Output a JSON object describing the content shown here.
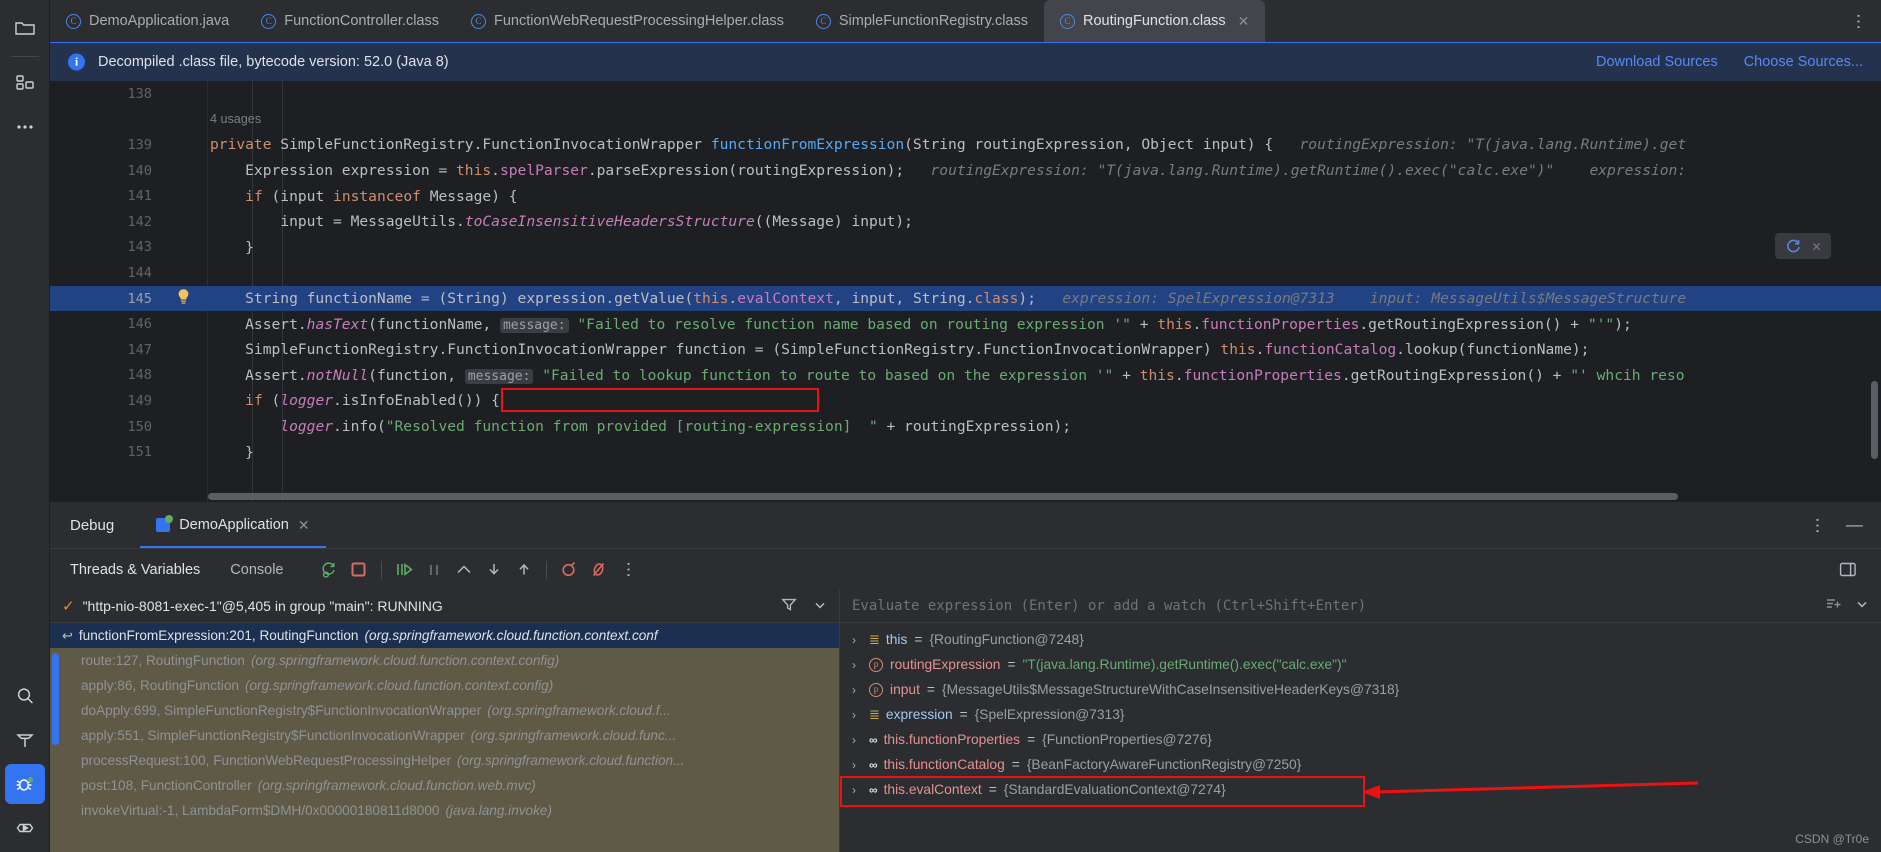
{
  "rail": {
    "icons": [
      {
        "name": "project-folder-icon",
        "label": "Project"
      },
      {
        "name": "structure-icon",
        "label": "Structure"
      },
      {
        "name": "more-tool-windows-icon",
        "label": "More"
      },
      {
        "name": "search-icon",
        "label": "Search"
      },
      {
        "name": "build-hammer-icon",
        "label": "Build"
      },
      {
        "name": "debug-bug-icon",
        "label": "Debug"
      },
      {
        "name": "run-icon",
        "label": "Run"
      }
    ]
  },
  "tabs": [
    {
      "label": "DemoApplication.java",
      "icon": "java-class-icon",
      "active": false,
      "closable": false
    },
    {
      "label": "FunctionController.class",
      "icon": "java-class-icon",
      "active": false,
      "closable": false
    },
    {
      "label": "FunctionWebRequestProcessingHelper.class",
      "icon": "java-class-icon",
      "active": false,
      "closable": false
    },
    {
      "label": "SimpleFunctionRegistry.class",
      "icon": "java-class-icon",
      "active": false,
      "closable": false
    },
    {
      "label": "RoutingFunction.class",
      "icon": "java-class-icon",
      "active": true,
      "closable": true
    }
  ],
  "banner": {
    "message": "Decompiled .class file, bytecode version: 52.0 (Java 8)",
    "download_sources": "Download Sources",
    "choose_sources": "Choose Sources..."
  },
  "editor": {
    "usage_label": "4 usages",
    "lines": [
      {
        "num": "138",
        "segments": []
      },
      {
        "num": "139",
        "segments": [
          {
            "t": "private ",
            "c": "kw"
          },
          {
            "t": "SimpleFunctionRegistry.FunctionInvocationWrapper ",
            "c": "ty"
          },
          {
            "t": "functionFromExpression",
            "c": "fn"
          },
          {
            "t": "(String routingExpression, Object input) {",
            "c": "pl"
          },
          {
            "t": "   routingExpression: \"T(java.lang.Runtime).get",
            "c": "hint"
          }
        ]
      },
      {
        "num": "140",
        "segments": [
          {
            "t": "    Expression expression = ",
            "c": "pl"
          },
          {
            "t": "this",
            "c": "kw"
          },
          {
            "t": ".",
            "c": "pl"
          },
          {
            "t": "spelParser",
            "c": "fld"
          },
          {
            "t": ".parseExpression(routingExpression);",
            "c": "pl"
          },
          {
            "t": "   routingExpression: \"T(java.lang.Runtime).getRuntime().exec(\"calc.exe\")\"    expression:",
            "c": "hint"
          }
        ]
      },
      {
        "num": "141",
        "segments": [
          {
            "t": "    ",
            "c": "pl"
          },
          {
            "t": "if",
            "c": "kw"
          },
          {
            "t": " (input ",
            "c": "pl"
          },
          {
            "t": "instanceof",
            "c": "kw"
          },
          {
            "t": " Message) {",
            "c": "pl"
          }
        ]
      },
      {
        "num": "142",
        "segments": [
          {
            "t": "        input = MessageUtils.",
            "c": "pl"
          },
          {
            "t": "toCaseInsensitiveHeadersStructure",
            "c": "statf"
          },
          {
            "t": "((Message) input);",
            "c": "pl"
          }
        ]
      },
      {
        "num": "143",
        "segments": [
          {
            "t": "    }",
            "c": "pl"
          }
        ]
      },
      {
        "num": "144",
        "segments": []
      },
      {
        "num": "145",
        "highlight": true,
        "bulb": true,
        "segments": [
          {
            "t": "    String functionName = (String) ",
            "c": "pl"
          },
          {
            "t": "expression.getValue(",
            "c": "pl"
          },
          {
            "t": "this",
            "c": "kw"
          },
          {
            "t": ".",
            "c": "pl"
          },
          {
            "t": "evalContext",
            "c": "fld"
          },
          {
            "t": ", input, String.",
            "c": "pl"
          },
          {
            "t": "class",
            "c": "kw"
          },
          {
            "t": ");",
            "c": "pl"
          },
          {
            "t": "   expression: SpelExpression@7313    input: MessageUtils$MessageStructure",
            "c": "hint"
          }
        ]
      },
      {
        "num": "146",
        "segments": [
          {
            "t": "    Assert.",
            "c": "pl"
          },
          {
            "t": "hasText",
            "c": "statf"
          },
          {
            "t": "(functionName, ",
            "c": "pl"
          },
          {
            "t": "message:",
            "c": "pnam"
          },
          {
            "t": " \"Failed to resolve function name based on routing expression '\"",
            "c": "str"
          },
          {
            "t": " + ",
            "c": "pl"
          },
          {
            "t": "this",
            "c": "kw"
          },
          {
            "t": ".",
            "c": "pl"
          },
          {
            "t": "functionProperties",
            "c": "fld"
          },
          {
            "t": ".getRoutingExpression() + ",
            "c": "pl"
          },
          {
            "t": "\"'\"",
            "c": "str"
          },
          {
            "t": ");",
            "c": "pl"
          }
        ]
      },
      {
        "num": "147",
        "segments": [
          {
            "t": "    SimpleFunctionRegistry.FunctionInvocationWrapper function = (SimpleFunctionRegistry.FunctionInvocationWrapper) ",
            "c": "pl"
          },
          {
            "t": "this",
            "c": "kw"
          },
          {
            "t": ".",
            "c": "pl"
          },
          {
            "t": "functionCatalog",
            "c": "fld"
          },
          {
            "t": ".lookup(functionName);",
            "c": "pl"
          }
        ]
      },
      {
        "num": "148",
        "segments": [
          {
            "t": "    Assert.",
            "c": "pl"
          },
          {
            "t": "notNull",
            "c": "statf"
          },
          {
            "t": "(function, ",
            "c": "pl"
          },
          {
            "t": "message:",
            "c": "pnam"
          },
          {
            "t": " \"Failed to lookup function to route to based on the expression '\"",
            "c": "str"
          },
          {
            "t": " + ",
            "c": "pl"
          },
          {
            "t": "this",
            "c": "kw"
          },
          {
            "t": ".",
            "c": "pl"
          },
          {
            "t": "functionProperties",
            "c": "fld"
          },
          {
            "t": ".getRoutingExpression() + ",
            "c": "pl"
          },
          {
            "t": "\"' whcih reso",
            "c": "str"
          }
        ]
      },
      {
        "num": "149",
        "segments": [
          {
            "t": "    ",
            "c": "pl"
          },
          {
            "t": "if",
            "c": "kw"
          },
          {
            "t": " (",
            "c": "pl"
          },
          {
            "t": "logger",
            "c": "statf"
          },
          {
            "t": ".isInfoEnabled()) {",
            "c": "pl"
          }
        ]
      },
      {
        "num": "150",
        "segments": [
          {
            "t": "        ",
            "c": "pl"
          },
          {
            "t": "logger",
            "c": "statf"
          },
          {
            "t": ".info(",
            "c": "pl"
          },
          {
            "t": "\"Resolved function from provided [routing-expression]  \"",
            "c": "str"
          },
          {
            "t": " + routingExpression);",
            "c": "pl"
          }
        ]
      },
      {
        "num": "151",
        "segments": [
          {
            "t": "    }",
            "c": "pl"
          }
        ]
      }
    ]
  },
  "debug": {
    "title": "Debug",
    "tab_label": "DemoApplication",
    "subtabs": [
      {
        "label": "Threads & Variables",
        "active": true
      },
      {
        "label": "Console",
        "active": false
      }
    ],
    "toolbar_icons": [
      "rerun-icon",
      "stop-icon",
      "resume-program-icon",
      "pause-program-icon",
      "step-over-icon",
      "step-into-icon",
      "step-out-icon",
      "view-breakpoints-icon",
      "mute-breakpoints-icon",
      "more-options-icon"
    ],
    "layout_settings_icon": "layout-settings-icon",
    "minimize_icon": "minimize-icon",
    "options_icon": "options-kebab-icon",
    "thread": "\"http-nio-8081-exec-1\"@5,405 in group \"main\": RUNNING",
    "frames": [
      {
        "text": "functionFromExpression:201, RoutingFunction ",
        "pkg": "(org.springframework.cloud.function.context.conf",
        "selected": true
      },
      {
        "text": "route:127, RoutingFunction ",
        "pkg": "(org.springframework.cloud.function.context.config)",
        "selected": false
      },
      {
        "text": "apply:86, RoutingFunction ",
        "pkg": "(org.springframework.cloud.function.context.config)",
        "selected": false
      },
      {
        "text": "doApply:699, SimpleFunctionRegistry$FunctionInvocationWrapper ",
        "pkg": "(org.springframework.cloud.f...",
        "selected": false
      },
      {
        "text": "apply:551, SimpleFunctionRegistry$FunctionInvocationWrapper ",
        "pkg": "(org.springframework.cloud.func...",
        "selected": false
      },
      {
        "text": "processRequest:100, FunctionWebRequestProcessingHelper ",
        "pkg": "(org.springframework.cloud.function...",
        "selected": false
      },
      {
        "text": "post:108, FunctionController ",
        "pkg": "(org.springframework.cloud.function.web.mvc)",
        "selected": false
      },
      {
        "text": "invokeVirtual:-1, LambdaForm$DMH/0x00000180811d8000 ",
        "pkg": "(java.lang.invoke)",
        "selected": false
      }
    ],
    "watch_placeholder": "Evaluate expression (Enter) or add a watch (Ctrl+Shift+Enter)",
    "variables": [
      {
        "icon": "object-icon",
        "name": "this",
        "value": "{RoutingFunction@7248}",
        "value_kind": "obj",
        "highlight": false
      },
      {
        "icon": "param-icon",
        "name": "routingExpression",
        "value": "\"T(java.lang.Runtime).getRuntime().exec(\"calc.exe\")\"",
        "value_kind": "str",
        "highlight": false
      },
      {
        "icon": "param-icon",
        "name": "input",
        "value": "{MessageUtils$MessageStructureWithCaseInsensitiveHeaderKeys@7318}",
        "value_kind": "obj",
        "highlight": false
      },
      {
        "icon": "object-icon",
        "name": "expression",
        "value": "{SpelExpression@7313}",
        "value_kind": "obj",
        "highlight": false
      },
      {
        "icon": "field-icon",
        "name": "this.functionProperties",
        "value": "{FunctionProperties@7276}",
        "value_kind": "obj",
        "highlight": false
      },
      {
        "icon": "field-icon",
        "name": "this.functionCatalog",
        "value": "{BeanFactoryAwareFunctionRegistry@7250}",
        "value_kind": "obj",
        "highlight": false
      },
      {
        "icon": "field-icon",
        "name": "this.evalContext",
        "value": "{StandardEvaluationContext@7274}",
        "value_kind": "obj",
        "highlight": true
      }
    ]
  },
  "watermark": "CSDN @Tr0e",
  "colors": {
    "accent": "#3574f0",
    "annotation_red": "#ee1111",
    "banner_bg": "#25324d",
    "editor_bg": "#1e1f22",
    "panel_bg": "#2b2d30",
    "selection_blue": "#214283",
    "string_green": "#6aab73",
    "keyword_orange": "#cf8e6d"
  }
}
